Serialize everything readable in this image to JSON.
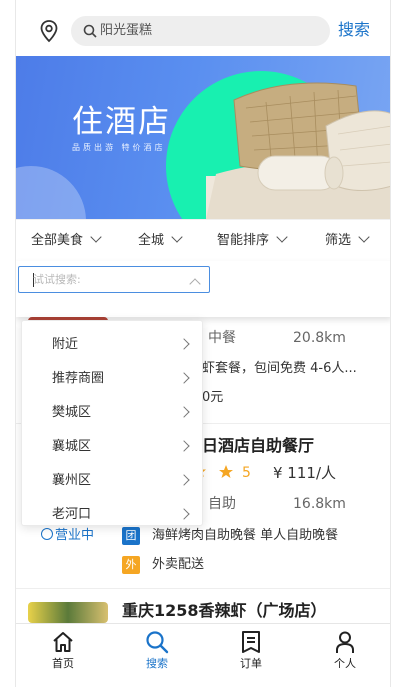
{
  "header": {
    "location_icon": "location-pin-icon",
    "search_placeholder": "阳光蛋糕",
    "search_button": "搜索"
  },
  "banner": {
    "title": "住酒店",
    "subtitle": "品质出游  特价酒店"
  },
  "filters": [
    {
      "label": "全部美食"
    },
    {
      "label": "全城"
    },
    {
      "label": "智能排序"
    },
    {
      "label": "筛选"
    }
  ],
  "dropdown": {
    "input_placeholder": "试试搜索:",
    "items": [
      {
        "label": "附近"
      },
      {
        "label": "推荐商圈"
      },
      {
        "label": "樊城区"
      },
      {
        "label": "襄城区"
      },
      {
        "label": "襄州区"
      },
      {
        "label": "老河口"
      }
    ]
  },
  "listings": [
    {
      "category": "中餐",
      "distance": "20.8km",
      "deal": "虾套餐，包间免费  4-6人...",
      "price_tail": "0元"
    },
    {
      "name_partial": "日酒店自助餐厅",
      "rating": "5",
      "price": "¥ 111/人",
      "category": "自助",
      "distance": "16.8km",
      "status": "营业中",
      "tag_group": "团",
      "group_deal": "海鲜烤肉自助晚餐   单人自助晚餐",
      "tag_delivery": "外",
      "delivery": "外卖配送"
    },
    {
      "name": "重庆1258香辣虾（广场店）"
    }
  ],
  "tabbar": [
    {
      "label": "首页",
      "icon": "home-icon"
    },
    {
      "label": "搜索",
      "icon": "search-icon"
    },
    {
      "label": "订单",
      "icon": "order-icon"
    },
    {
      "label": "个人",
      "icon": "person-icon"
    }
  ],
  "colors": {
    "accent": "#1a73c9",
    "tag_blue": "#1a73c9",
    "tag_orange": "#f5a623",
    "star": "#f5a623"
  }
}
